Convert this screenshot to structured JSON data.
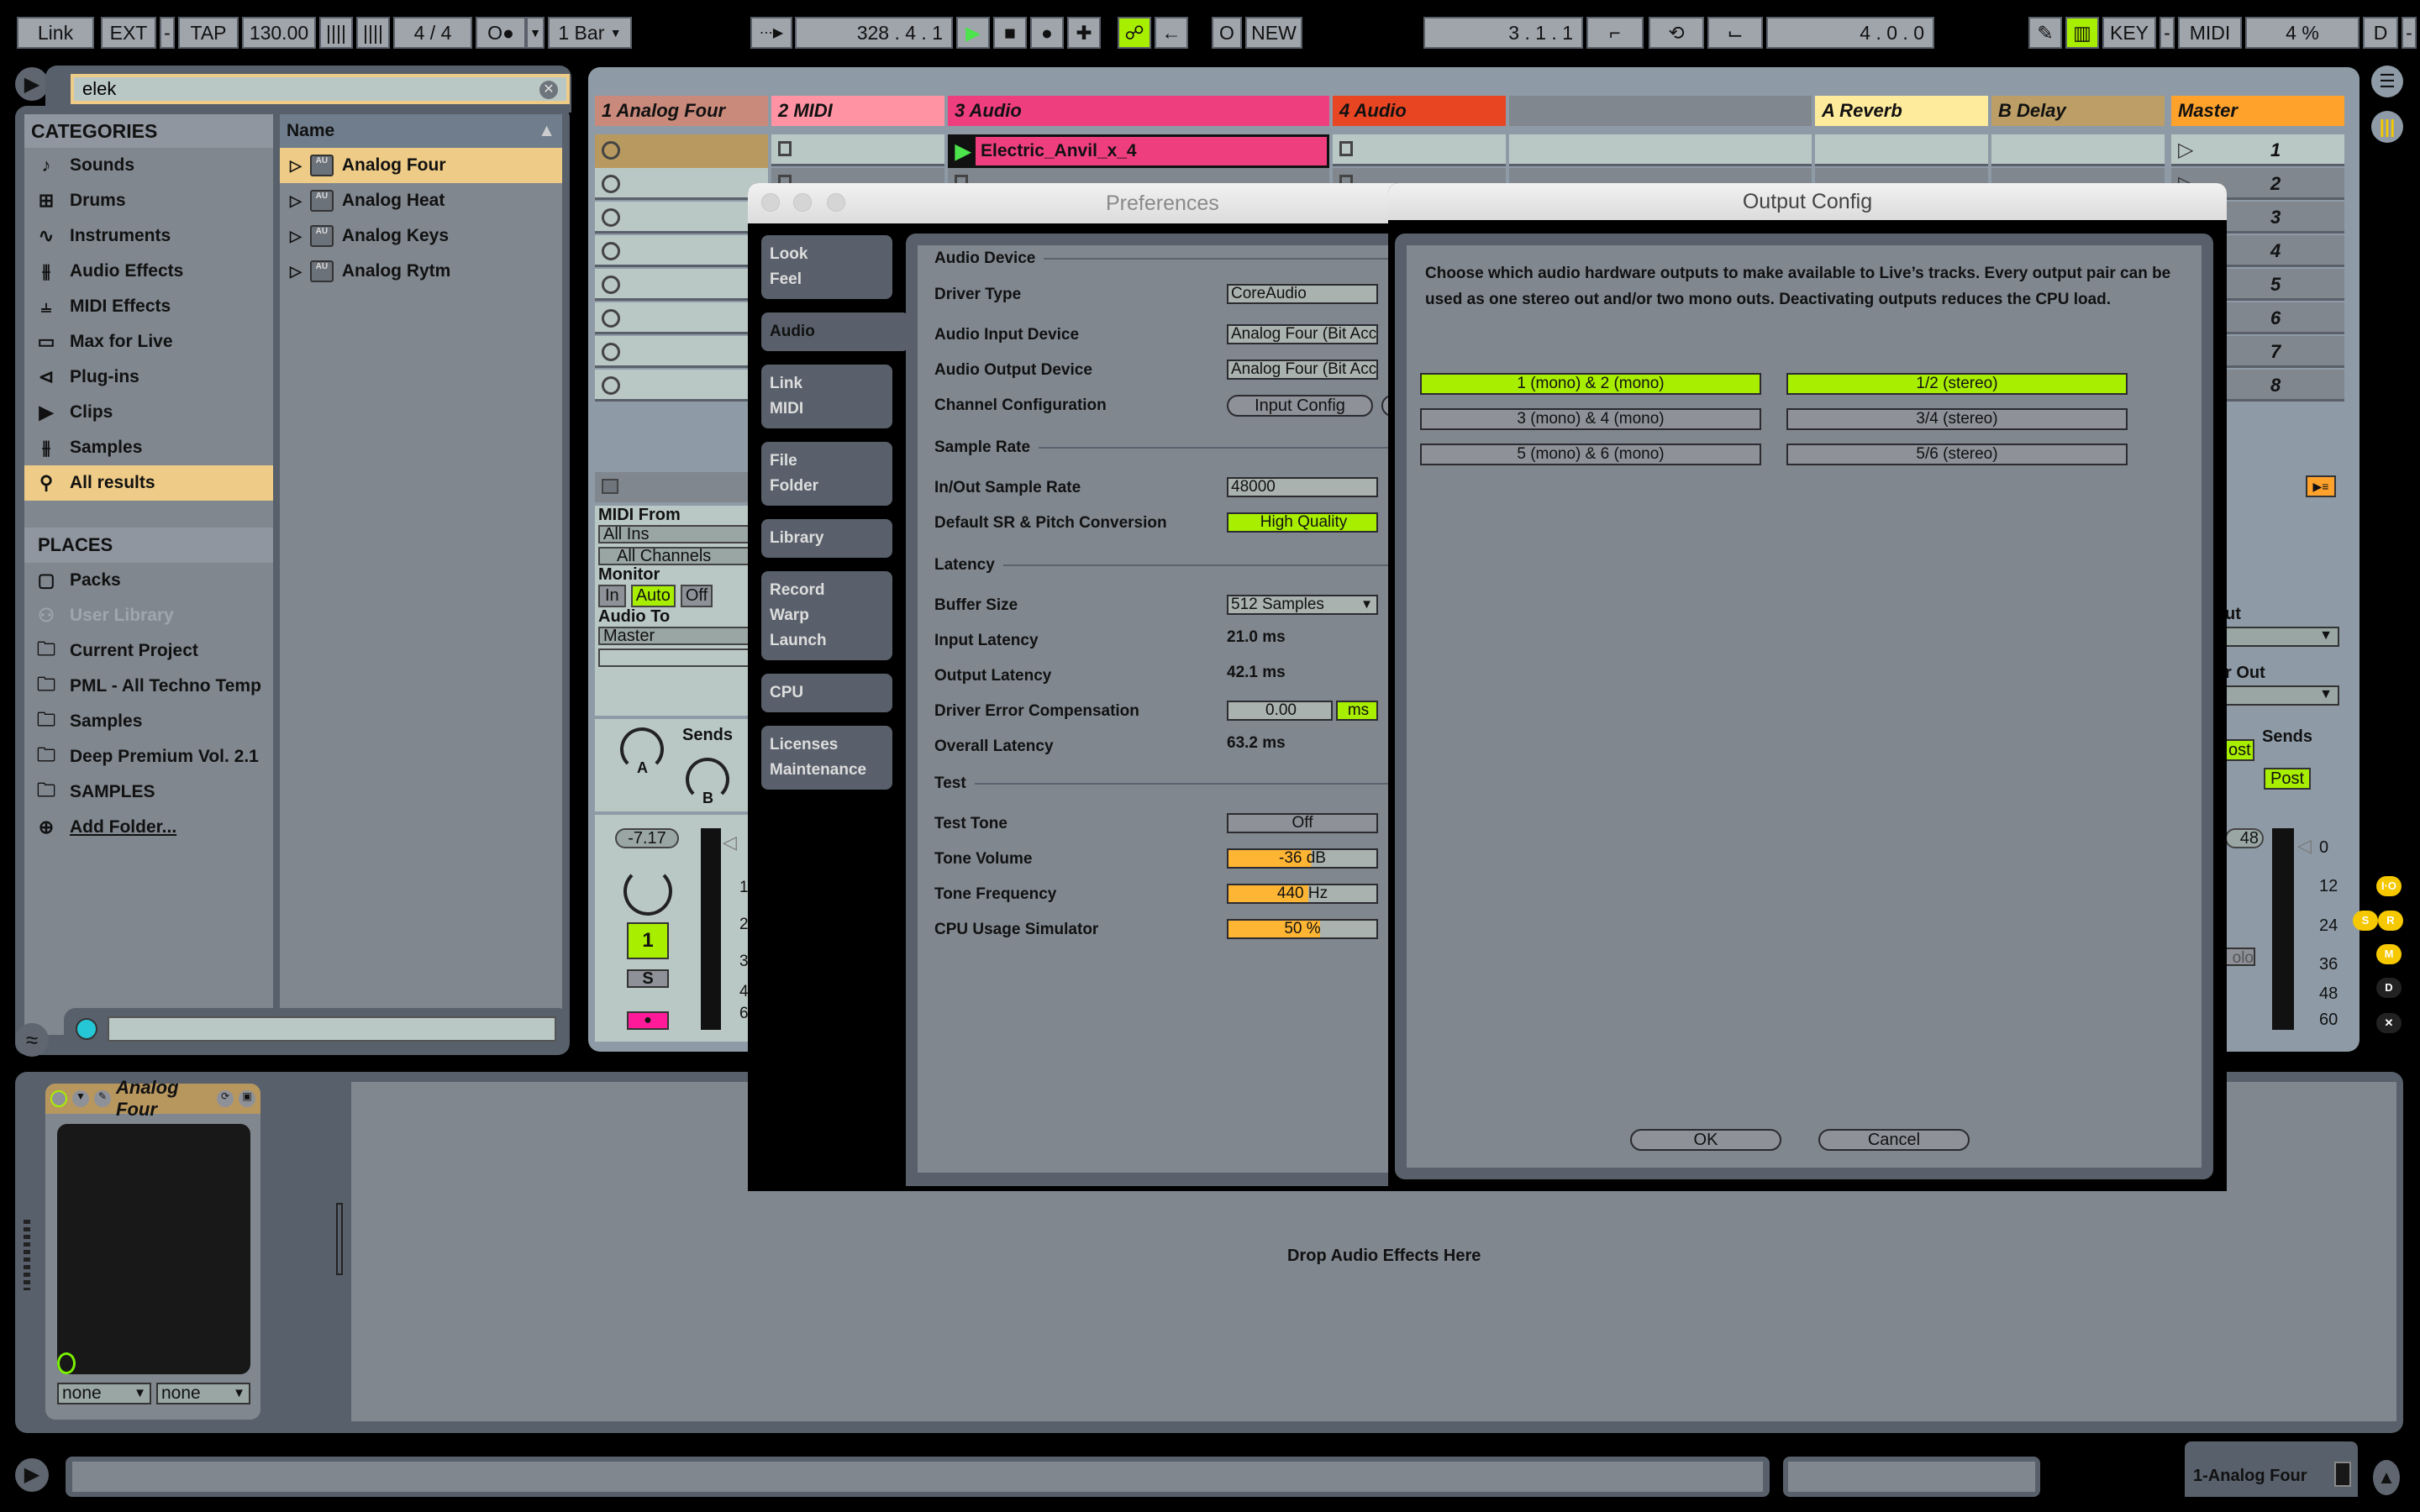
{
  "transport": {
    "link": "Link",
    "ext": "EXT",
    "tap": "TAP",
    "tempo": "130.00",
    "time_signature": "4 / 4",
    "quantization": "1 Bar",
    "position": "328 .  4 .  1",
    "new": "NEW",
    "loop_start": "3 .  1 .  1",
    "loop_length": "4 .  0 .  0",
    "key": "KEY",
    "midi": "MIDI",
    "cpu": "4 %",
    "d": "D"
  },
  "browser": {
    "search_value": "elek",
    "categories_title": "CATEGORIES",
    "categories": [
      {
        "label": "Sounds",
        "icon": "note-icon",
        "glyph": "♪"
      },
      {
        "label": "Drums",
        "icon": "grid-icon",
        "glyph": "⊞"
      },
      {
        "label": "Instruments",
        "icon": "wave-icon",
        "glyph": "∿"
      },
      {
        "label": "Audio Effects",
        "icon": "audio-effects-icon",
        "glyph": "⫵"
      },
      {
        "label": "MIDI Effects",
        "icon": "midi-effects-icon",
        "glyph": "⫨"
      },
      {
        "label": "Max for Live",
        "icon": "max-icon",
        "glyph": "▭"
      },
      {
        "label": "Plug-ins",
        "icon": "plug-icon",
        "glyph": "⊲"
      },
      {
        "label": "Clips",
        "icon": "clip-icon",
        "glyph": "▶"
      },
      {
        "label": "Samples",
        "icon": "samples-icon",
        "glyph": "⫵"
      },
      {
        "label": "All results",
        "icon": "search-icon",
        "glyph": "⚲",
        "selected": true
      }
    ],
    "places_title": "PLACES",
    "places": [
      {
        "label": "Packs",
        "icon": "packs-icon",
        "glyph": "▢"
      },
      {
        "label": "User Library",
        "icon": "user-icon",
        "glyph": "⚇",
        "disabled": true
      },
      {
        "label": "Current Project",
        "icon": "project-folder-icon",
        "glyph": "🗀"
      },
      {
        "label": "PML - All Techno Temp",
        "icon": "folder-icon",
        "glyph": "🗀"
      },
      {
        "label": "Samples",
        "icon": "folder-icon",
        "glyph": "🗀"
      },
      {
        "label": "Deep Premium Vol. 2.1",
        "icon": "folder-icon",
        "glyph": "🗀"
      },
      {
        "label": "SAMPLES",
        "icon": "folder-icon",
        "glyph": "🗀"
      },
      {
        "label": "Add Folder...",
        "icon": "add-icon",
        "glyph": "⊕"
      }
    ],
    "results_header": "Name",
    "results": [
      {
        "label": "Analog Four",
        "selected": true
      },
      {
        "label": "Analog Heat"
      },
      {
        "label": "Analog Keys"
      },
      {
        "label": "Analog Rytm"
      }
    ]
  },
  "session": {
    "tracks": [
      {
        "name": "1 Analog Four",
        "color": "#c98a7c"
      },
      {
        "name": "2 MIDI",
        "color": "#ff93a4"
      },
      {
        "name": "3 Audio",
        "color": "#ef3e7e"
      },
      {
        "name": "4 Audio",
        "color": "#e84522"
      },
      {
        "name": "A Reverb",
        "color": "#ffeb9c"
      },
      {
        "name": "B Delay",
        "color": "#bc9e66"
      },
      {
        "name": "Master",
        "color": "#ffa22c"
      }
    ],
    "clip": "Electric_Anvil_x_4",
    "scenes": [
      "1",
      "2",
      "3",
      "4",
      "5",
      "6",
      "7",
      "8"
    ],
    "io": {
      "midi_from_label": "MIDI From",
      "midi_from": "All Ins",
      "channels": "All Channels",
      "monitor_label": "Monitor",
      "monitor_in": "In",
      "monitor_auto": "Auto",
      "monitor_off": "Off",
      "audio_to_label": "Audio To",
      "audio_to": "Master"
    },
    "sends_label": "Sends",
    "send_a": "A",
    "send_b": "B",
    "volume": "-7.17",
    "track_number": "1",
    "solo": "S",
    "meter_labels": [
      "1",
      "2",
      "3",
      "4",
      "6"
    ],
    "master_meter_labels": [
      "0",
      "12",
      "24",
      "36",
      "48",
      "60"
    ],
    "master_volume": "48",
    "master_out_label": "ut",
    "cue_out_label": "r Out",
    "post": "Post",
    "post2": "ost",
    "solo_partial": "olo"
  },
  "preferences": {
    "title": "Preferences",
    "tabs": [
      {
        "lines": [
          "Look",
          "Feel"
        ]
      },
      {
        "lines": [
          "Audio"
        ],
        "selected": true
      },
      {
        "lines": [
          "Link",
          "MIDI"
        ]
      },
      {
        "lines": [
          "File",
          "Folder"
        ]
      },
      {
        "lines": [
          "Library"
        ]
      },
      {
        "lines": [
          "Record",
          "Warp",
          "Launch"
        ]
      },
      {
        "lines": [
          "CPU"
        ]
      },
      {
        "lines": [
          "Licenses",
          "Maintenance"
        ]
      }
    ],
    "audio_device_section": "Audio Device",
    "driver_type_label": "Driver Type",
    "driver_type": "CoreAudio",
    "input_device_label": "Audio Input Device",
    "input_device": "Analog Four (Bit Accu",
    "output_device_label": "Audio Output Device",
    "output_device": "Analog Four (Bit Accu",
    "channel_config_label": "Channel Configuration",
    "input_config": "Input Config",
    "sample_rate_section": "Sample Rate",
    "sample_rate_label": "In/Out Sample Rate",
    "sample_rate": "48000",
    "sr_conv_label": "Default SR & Pitch Conversion",
    "sr_conv": "High Quality",
    "latency_section": "Latency",
    "buffer_label": "Buffer Size",
    "buffer": "512 Samples",
    "input_latency_label": "Input Latency",
    "input_latency": "21.0 ms",
    "output_latency_label": "Output Latency",
    "output_latency": "42.1 ms",
    "driver_comp_label": "Driver Error Compensation",
    "driver_comp": "0.00",
    "driver_comp_unit": "ms",
    "overall_latency_label": "Overall Latency",
    "overall_latency": "63.2 ms",
    "test_section": "Test",
    "test_tone_label": "Test Tone",
    "test_tone": "Off",
    "tone_volume_label": "Tone Volume",
    "tone_volume": "-36 dB",
    "tone_volume_fill": 0.56,
    "tone_freq_label": "Tone Frequency",
    "tone_freq": "440 Hz",
    "tone_freq_fill": 0.54,
    "cpu_sim_label": "CPU Usage Simulator",
    "cpu_sim": "50 %",
    "cpu_sim_fill": 0.62
  },
  "output_config": {
    "title": "Output Config",
    "description": "Choose which audio hardware outputs to make available to Live’s tracks. Every output pair can be used as one stereo out and/or two mono outs.  Deactivating outputs reduces the CPU load.",
    "mono": [
      {
        "label": "1 (mono) & 2 (mono)",
        "active": true
      },
      {
        "label": "3 (mono) & 4 (mono)",
        "active": false
      },
      {
        "label": "5 (mono) & 6 (mono)",
        "active": false
      }
    ],
    "stereo": [
      {
        "label": "1/2 (stereo)",
        "active": true
      },
      {
        "label": "3/4 (stereo)",
        "active": false
      },
      {
        "label": "5/6 (stereo)",
        "active": false
      }
    ],
    "ok": "OK",
    "cancel": "Cancel"
  },
  "device": {
    "name": "Analog Four",
    "macro1": "none",
    "macro2": "none",
    "drop_hint": "Drop Audio Effects Here"
  },
  "status": {
    "selected_track": "1-Analog Four"
  },
  "side_toggles": [
    "I·O",
    "S",
    "R",
    "M",
    "D",
    "✕"
  ]
}
